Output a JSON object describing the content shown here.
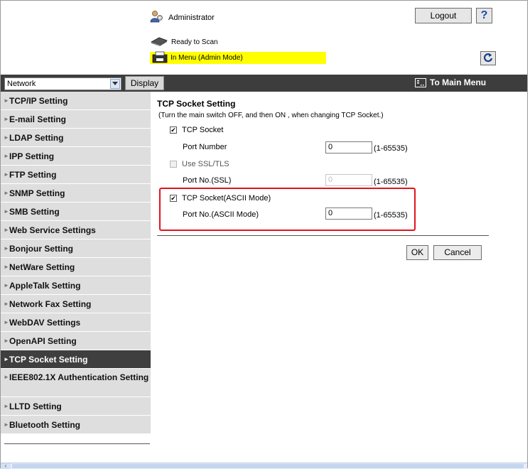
{
  "header": {
    "user": "Administrator",
    "logout_label": "Logout",
    "help_label": "?",
    "status_ready": "Ready to Scan",
    "status_menu": "In Menu (Admin Mode)"
  },
  "toolbar": {
    "category_value": "Network",
    "display_label": "Display",
    "to_main_menu": "To Main Menu"
  },
  "sidebar": {
    "items": [
      {
        "label": "TCP/IP Setting"
      },
      {
        "label": "E-mail Setting"
      },
      {
        "label": "LDAP Setting"
      },
      {
        "label": "IPP Setting"
      },
      {
        "label": "FTP Setting"
      },
      {
        "label": "SNMP Setting"
      },
      {
        "label": "SMB Setting"
      },
      {
        "label": "Web Service Settings"
      },
      {
        "label": "Bonjour Setting"
      },
      {
        "label": "NetWare Setting"
      },
      {
        "label": "AppleTalk Setting"
      },
      {
        "label": "Network Fax Setting"
      },
      {
        "label": "WebDAV Settings"
      },
      {
        "label": "OpenAPI Setting"
      },
      {
        "label": "TCP Socket Setting"
      },
      {
        "label": "IEEE802.1X Authentication Setting"
      },
      {
        "label": "LLTD Setting"
      },
      {
        "label": "Bluetooth Setting"
      }
    ]
  },
  "main": {
    "title": "TCP Socket Setting",
    "note": "(Turn the main switch OFF, and then ON , when changing TCP Socket.)",
    "tcp_socket_label": "TCP Socket",
    "tcp_socket_checked": true,
    "port_number_label": "Port Number",
    "port_number_value": "0",
    "port_number_range": "(1-65535)",
    "ssl_label": "Use SSL/TLS",
    "ssl_checked": false,
    "ssl_port_label": "Port No.(SSL)",
    "ssl_port_value": "0",
    "ssl_port_range": "(1-65535)",
    "ascii_label": "TCP Socket(ASCII Mode)",
    "ascii_checked": true,
    "ascii_port_label": "Port No.(ASCII Mode)",
    "ascii_port_value": "0",
    "ascii_port_range": "(1-65535)",
    "ok_label": "OK",
    "cancel_label": "Cancel"
  },
  "colors": {
    "highlight_border": "#e0141e",
    "status_bar": "#ffff00",
    "active_item": "#3f3f3f"
  }
}
